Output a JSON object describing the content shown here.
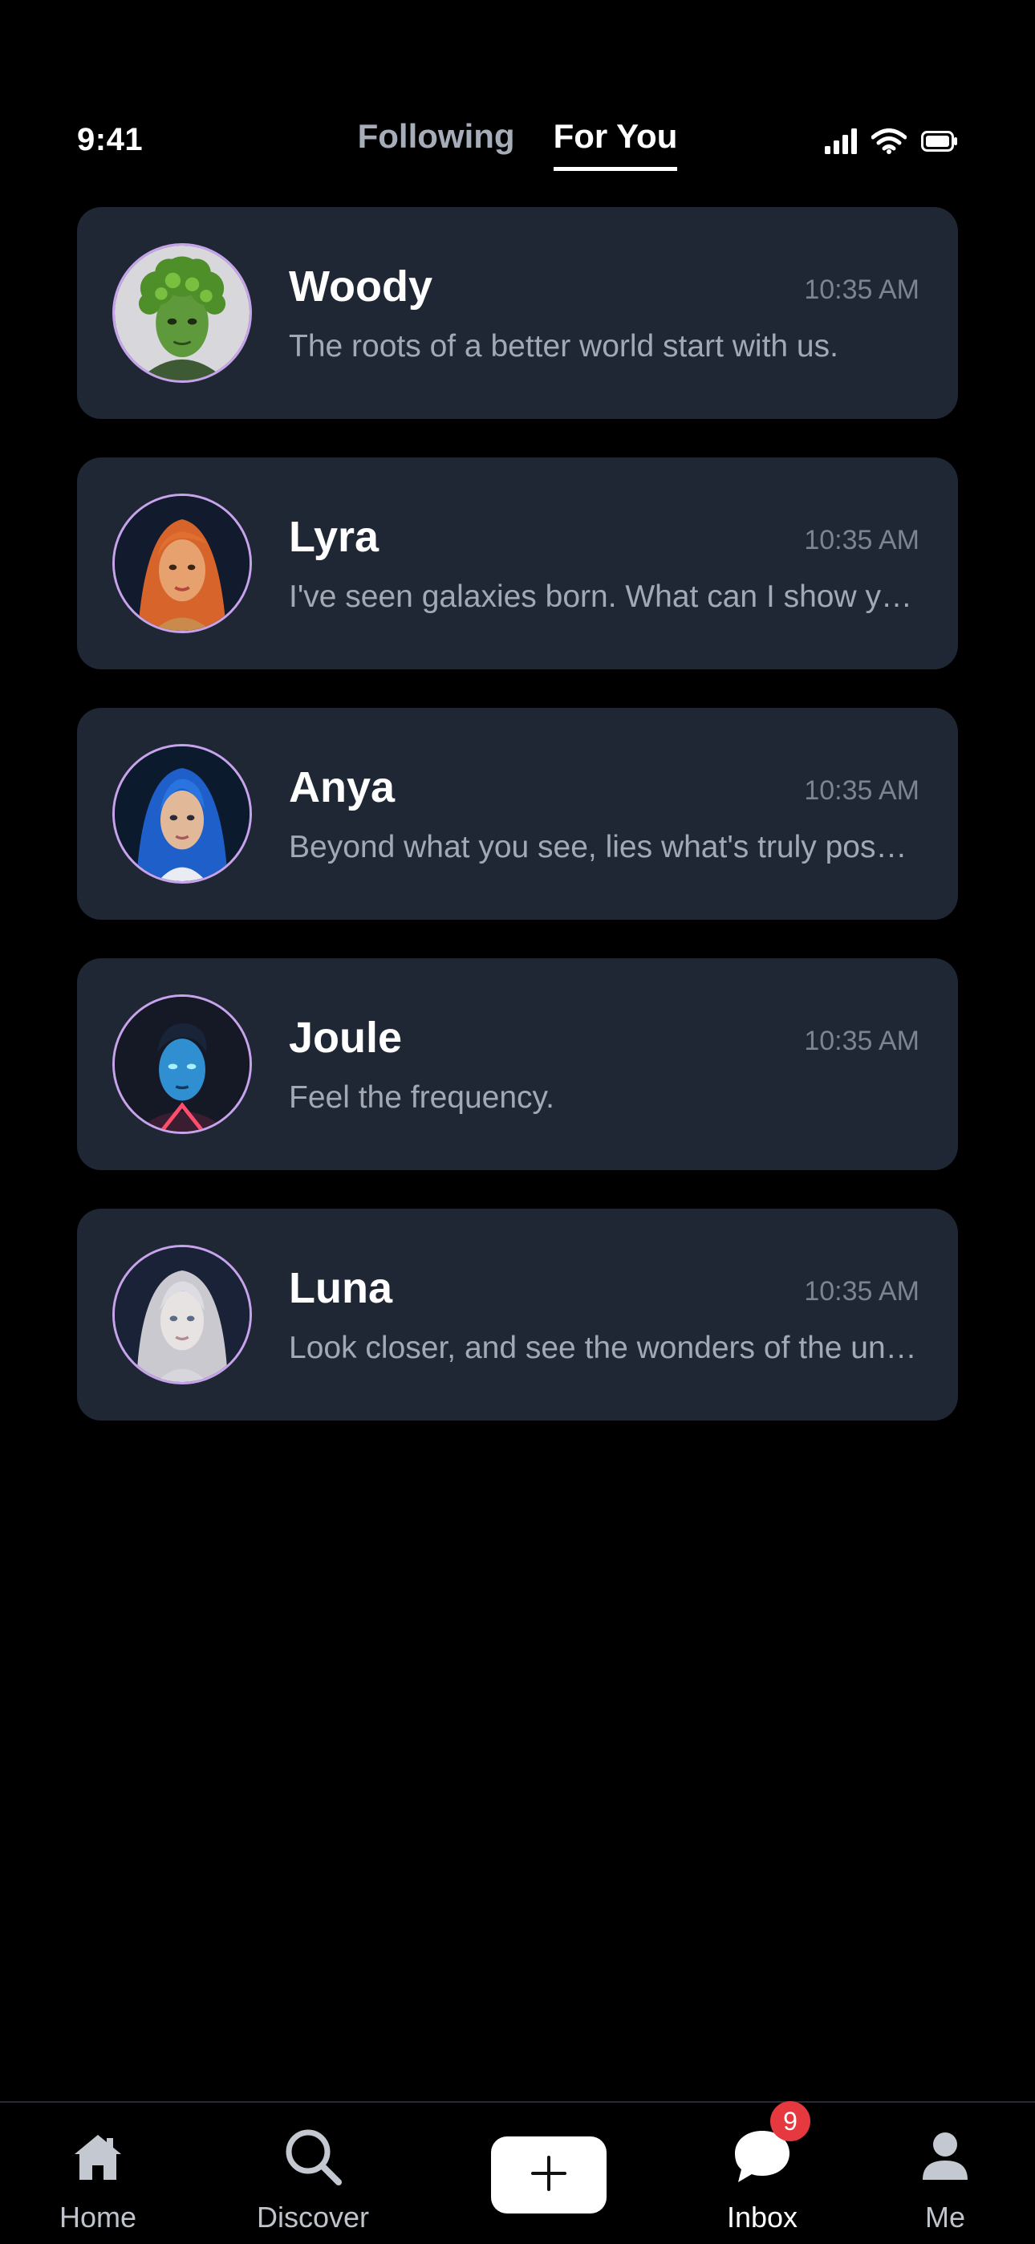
{
  "status_bar": {
    "time": "9:41",
    "icons": [
      "cellular-signal-icon",
      "wifi-icon",
      "battery-icon"
    ]
  },
  "top_tabs": [
    {
      "label": "Following",
      "active": false
    },
    {
      "label": "For You",
      "active": true
    }
  ],
  "chats": [
    {
      "name": "Woody",
      "time": "10:35 AM",
      "preview": "The roots of a better world start with us.",
      "avatar": "woody-avatar"
    },
    {
      "name": "Lyra",
      "time": "10:35 AM",
      "preview": "I've seen galaxies born. What can I show you today?",
      "avatar": "lyra-avatar"
    },
    {
      "name": "Anya",
      "time": "10:35 AM",
      "preview": "Beyond what you see, lies what's truly possible.",
      "avatar": "anya-avatar"
    },
    {
      "name": "Joule",
      "time": "10:35 AM",
      "preview": "Feel the frequency.",
      "avatar": "joule-avatar"
    },
    {
      "name": "Luna",
      "time": "10:35 AM",
      "preview": "Look closer, and see the wonders of the universe.",
      "avatar": "luna-avatar"
    }
  ],
  "bottom_nav": {
    "home": {
      "label": "Home",
      "icon": "home-icon"
    },
    "discover": {
      "label": "Discover",
      "icon": "search-icon"
    },
    "create": {
      "icon": "plus-icon"
    },
    "inbox": {
      "label": "Inbox",
      "icon": "chat-bubble-icon",
      "badge": "9"
    },
    "me": {
      "label": "Me",
      "icon": "person-icon"
    }
  },
  "colors": {
    "background": "#000000",
    "card": "#1f2735",
    "avatar_ring": "#c7a3ec",
    "badge": "#e5383f"
  }
}
